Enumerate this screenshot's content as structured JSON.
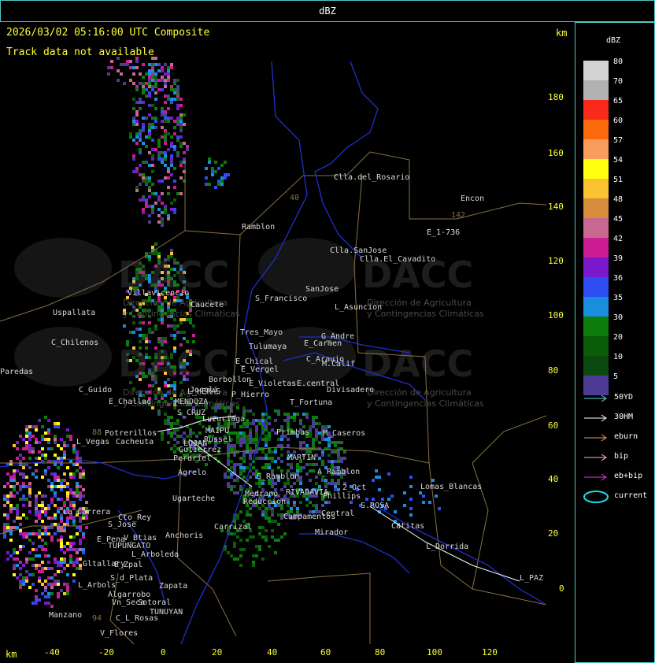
{
  "title": "dBZ",
  "timestamp": "2026/03/02 05:16:00 UTC Composite",
  "track_status": "Track data not available",
  "axis_unit": "km",
  "y_ticks": [
    "180",
    "160",
    "140",
    "120",
    "100",
    "80",
    "60",
    "40",
    "20",
    "0"
  ],
  "x_ticks": [
    "-40",
    "-20",
    "0",
    "20",
    "40",
    "60",
    "80",
    "100",
    "120"
  ],
  "legend": {
    "header": "dBZ",
    "scale": [
      {
        "label": "80",
        "color": "#d3d3d3"
      },
      {
        "label": "70",
        "color": "#b2b2b2"
      },
      {
        "label": "65",
        "color": "#fa2a1a"
      },
      {
        "label": "60",
        "color": "#fb6a0c"
      },
      {
        "label": "57",
        "color": "#f89c5c"
      },
      {
        "label": "54",
        "color": "#ffff0e"
      },
      {
        "label": "51",
        "color": "#fbc232"
      },
      {
        "label": "48",
        "color": "#d68e3c"
      },
      {
        "label": "45",
        "color": "#c86890"
      },
      {
        "label": "42",
        "color": "#cc1c94"
      },
      {
        "label": "39",
        "color": "#7a18cc"
      },
      {
        "label": "36",
        "color": "#2c4ef2"
      },
      {
        "label": "35",
        "color": "#1a8ede"
      },
      {
        "label": "30",
        "color": "#0c7c0c"
      },
      {
        "label": "20",
        "color": "#0a5c0a"
      },
      {
        "label": "10",
        "color": "#0a4a10"
      },
      {
        "label": "5",
        "color": "#4c3c96"
      }
    ],
    "tracks": [
      {
        "label": "50YD",
        "color": "#4fd8e0"
      },
      {
        "label": "30HM",
        "color": "#ffffff"
      },
      {
        "label": "eburn",
        "color": "#f0a060"
      },
      {
        "label": "bip",
        "color": "#f8b8c8"
      },
      {
        "label": "eb+bip",
        "color": "#e040e0"
      },
      {
        "label": "current",
        "color": "#20d8e8"
      }
    ]
  },
  "watermark": {
    "name": "DACC",
    "line1": "Dirección de Agricultura",
    "line2": "y Contingencias Climáticas"
  },
  "places": [
    "Clla.del_Rosario",
    "Encon",
    "142",
    "E_1-736",
    "Ramblon",
    "40",
    "Clla.SanJose",
    "Clla.El_Cavadito",
    "Villavicencio",
    "Uspallata",
    "Caucete",
    "S_Francisco",
    "SanJose",
    "L_Asuncion",
    "Tres_Mayo",
    "Tulumaya",
    "G_Andre",
    "E_Carmen",
    "C_Chilenos",
    "E_Chical",
    "E_Vergel",
    "C_Araujo",
    "M.Calif",
    "Paredas",
    "Borbollon",
    "Jocoli",
    "E_Violetas",
    "E.central",
    "Divisadero",
    "C_Guido",
    "L_HERAS",
    "P_Hierro",
    "E_Challao",
    "MENDOZA",
    "S_CRUZ",
    "T_Fortuna",
    "Luzuriaga",
    "88",
    "Potrerillos",
    "MAIPU",
    "Russel",
    "Cacheuta",
    "LUJAN",
    "L_Vegas",
    "Gutierrez",
    "Perdriel",
    "Primbas",
    "M_Caseros",
    "MARTIN",
    "A_Ramblon",
    "Agrelo",
    "S_Ramblon",
    "RIVADAVIA",
    "2_Oct",
    "Lomas_Blancas",
    "Medrano",
    "Reduccion",
    "Phillips",
    "S.ROSA",
    "Ugarteche",
    "La_Carrera",
    "Cto_Rey",
    "S_Jose",
    "Carrizal",
    "Campamentos",
    "Central",
    "Catitas",
    "E_Pena",
    "V_Btias",
    "Anchoris",
    "TUPUNGATO",
    "Mirador",
    "L_Dorrida",
    "L_Arboleda",
    "Gltallary",
    "E_Zpal",
    "S_d_Plata",
    "Zapata",
    "L_Arbols",
    "Algarrobo",
    "Vn_Seca",
    "Sotoral",
    "L_PAZ",
    "TUNUYAN",
    "Manzano",
    "94",
    "C_L_Rosas",
    "V_Flores"
  ],
  "chart_data": {
    "type": "map",
    "title": "dBZ",
    "xlabel": "km",
    "ylabel": "km",
    "xlim": [
      -60,
      140
    ],
    "ylim": [
      -18,
      200
    ],
    "x_ticks": [
      -40,
      -20,
      0,
      20,
      40,
      60,
      80,
      100,
      120
    ],
    "y_ticks": [
      0,
      20,
      40,
      60,
      80,
      100,
      120,
      140,
      160,
      180
    ]
  }
}
